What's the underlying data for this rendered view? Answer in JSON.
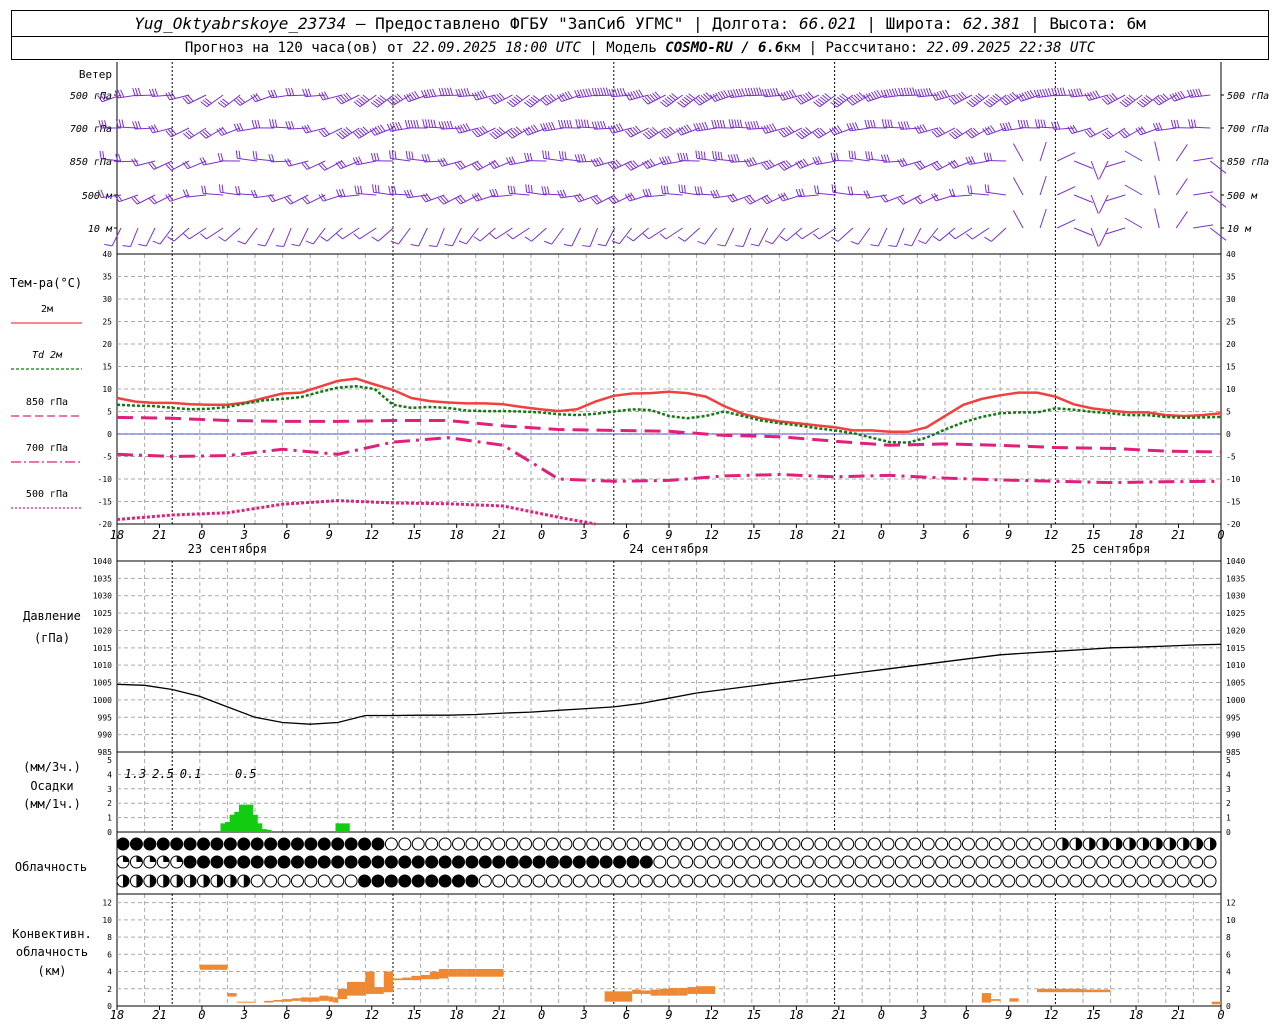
{
  "header": {
    "station": "Yug_Oktyabrskoye_23734",
    "provided_prefix": " – Предоставлено ФГБУ \"ЗапСиб УГМС\" | Долгота: ",
    "longitude": "66.021",
    "lat_prefix": " | Широта: ",
    "latitude": "62.381",
    "elev_prefix": " | Высота: ",
    "elevation": "6м",
    "forecast_prefix": "Прогноз на 120 часа(ов) от ",
    "forecast_start": "22.09.2025 18:00 UTC",
    "model_prefix": "  | Модель ",
    "model": "COSMO-RU / 6.6",
    "model_res_unit": "км",
    "calc_prefix": " | Рассчитано: ",
    "calculated": "22.09.2025 22:38 UTC"
  },
  "colors": {
    "t2m": "#f04040",
    "td2m": "#127a12",
    "t850": "#e0207a",
    "t700": "#e0207a",
    "t500": "#e0207a",
    "wind": "#7b2fd1",
    "pressure": "#000000",
    "precip": "#11cc11",
    "convective": "#ee8833",
    "zero_line": "#2020c0",
    "grid": "#aaaaaa"
  },
  "time_axis": {
    "hour_labels": [
      "18",
      "21",
      "0",
      "3",
      "6",
      "9",
      "12",
      "15",
      "18",
      "21",
      "0",
      "3",
      "6",
      "9",
      "12",
      "15",
      "18",
      "21",
      "0",
      "3",
      "6",
      "9",
      "12",
      "15",
      "18",
      "21",
      "0"
    ],
    "date_labels": [
      "23 сентября",
      "24 сентября",
      "25 сентября"
    ]
  },
  "wind": {
    "title": "Ветер",
    "levels": [
      "500 гПа",
      "700 гПа",
      "850 гПа",
      "500 м",
      "10  м"
    ],
    "right_levels": [
      "500 гПа",
      "700 гПа",
      "850 гПа",
      "500 м",
      "10  м"
    ]
  },
  "temperature": {
    "title": "Тем-ра(°C)",
    "legend": [
      "2м",
      "Td  2м",
      "850 гПа",
      "700 гПа",
      "500 гПа"
    ],
    "yticks": [
      "40",
      "35",
      "30",
      "25",
      "20",
      "15",
      "10",
      "5",
      "0",
      "-5",
      "-10",
      "-15",
      "-20"
    ]
  },
  "pressure": {
    "title": "Давление",
    "unit": "(гПа)",
    "yticks": [
      "1040",
      "1035",
      "1030",
      "1025",
      "1020",
      "1015",
      "1010",
      "1005",
      "1000",
      "995",
      "990",
      "985"
    ]
  },
  "precip": {
    "unit_top": "(мм/3ч.)",
    "title": "Осадки",
    "unit_bottom": "(мм/1ч.)",
    "yticks": [
      "5",
      "4",
      "3",
      "2",
      "1",
      "0"
    ],
    "labels": [
      {
        "hour": 1.5,
        "text": "1.3"
      },
      {
        "hour": 4.5,
        "text": "2.5"
      },
      {
        "hour": 7.5,
        "text": "0.1"
      },
      {
        "hour": 13.5,
        "text": "0.5"
      }
    ]
  },
  "cloud": {
    "title": "Облачность"
  },
  "convective": {
    "title_1": "Конвективн.",
    "title_2": "облачность",
    "unit": "(км)",
    "yticks": [
      "12",
      "10",
      "8",
      "6",
      "4",
      "2",
      "0"
    ]
  },
  "chart_data": [
    {
      "type": "line",
      "title": "Тем-ра(°C)",
      "x_unit": "hours from 22.09.2025 18:00 UTC",
      "ylim": [
        -20,
        40
      ],
      "series": [
        {
          "name": "2м",
          "x": [
            0,
            2,
            4,
            6,
            8,
            10,
            12,
            14,
            16,
            18,
            20,
            22,
            24,
            26,
            28,
            30,
            32,
            34,
            36,
            38,
            40,
            42,
            44,
            46,
            48,
            50,
            52,
            54,
            56,
            58,
            60,
            62,
            64,
            66,
            68,
            70,
            72,
            74,
            76,
            78,
            80,
            82,
            84,
            86,
            88,
            90,
            92,
            94,
            96,
            98,
            100,
            102,
            104,
            106,
            108,
            110,
            112,
            114,
            116,
            118,
            120
          ],
          "values": [
            8,
            7.2,
            6.9,
            6.9,
            6.6,
            6.5,
            6.5,
            7,
            8,
            9,
            9.2,
            10.5,
            11.8,
            12.3,
            11,
            9.8,
            8,
            7.3,
            7,
            6.8,
            6.8,
            6.6,
            6,
            5.5,
            5.1,
            5.5,
            7.2,
            8.5,
            9,
            9.1,
            9.4,
            9.1,
            8.3,
            6.2,
            4.5,
            3.5,
            2.8,
            2.4,
            1.9,
            1.5,
            0.8,
            0.8,
            0.5,
            0.5,
            1.5,
            4,
            6.5,
            7.8,
            8.6,
            9.2,
            9.2,
            8.3,
            6.6,
            5.7,
            5.2,
            4.8,
            4.8,
            4.2,
            4,
            4.2,
            4.6
          ]
        },
        {
          "name": "Td  2м",
          "x": [
            0,
            2,
            4,
            6,
            8,
            10,
            12,
            14,
            16,
            18,
            20,
            22,
            24,
            26,
            28,
            30,
            32,
            34,
            36,
            38,
            40,
            42,
            44,
            46,
            48,
            50,
            52,
            54,
            56,
            58,
            60,
            62,
            64,
            66,
            68,
            70,
            72,
            74,
            76,
            78,
            80,
            82,
            84,
            86,
            88,
            90,
            92,
            94,
            96,
            98,
            100,
            102,
            104,
            106,
            108,
            110,
            112,
            114,
            116,
            118,
            120
          ],
          "values": [
            6.5,
            6.3,
            6.2,
            5.8,
            5.5,
            5.6,
            6,
            6.8,
            7.5,
            7.8,
            8.2,
            9.3,
            10.3,
            10.6,
            10,
            6.5,
            5.8,
            6,
            5.8,
            5.2,
            5.1,
            5.1,
            5,
            4.8,
            4.4,
            4.2,
            4.5,
            5,
            5.5,
            5.3,
            4,
            3.5,
            4,
            5,
            4,
            3,
            2.4,
            1.9,
            1.3,
            0.8,
            0.2,
            -0.8,
            -1.8,
            -1.9,
            -0.8,
            1,
            2.6,
            3.8,
            4.6,
            4.8,
            4.8,
            5.7,
            5.4,
            4.9,
            4.6,
            4.2,
            4.2,
            3.8,
            3.6,
            3.7,
            3.8
          ]
        },
        {
          "name": "850 гПа",
          "x": [
            0,
            6,
            12,
            18,
            24,
            30,
            36,
            42,
            48,
            54,
            60,
            66,
            72,
            78,
            84,
            90,
            96,
            102,
            108,
            114,
            120
          ],
          "values": [
            3.7,
            3.5,
            3,
            2.8,
            2.8,
            3,
            3,
            1.8,
            1,
            0.8,
            0.6,
            -0.3,
            -0.6,
            -1.6,
            -2.5,
            -2.2,
            -2.5,
            -3,
            -3.2,
            -3.8,
            -4
          ]
        },
        {
          "name": "700 гПа",
          "x": [
            0,
            6,
            12,
            18,
            24,
            30,
            36,
            42,
            48,
            54,
            60,
            66,
            72,
            78,
            84,
            90,
            96,
            102,
            108,
            114,
            120
          ],
          "values": [
            -4.5,
            -5,
            -4.8,
            -3.4,
            -4.5,
            -1.8,
            -0.8,
            -2.5,
            -10,
            -10.5,
            -10.3,
            -9.3,
            -9,
            -9.5,
            -9.2,
            -9.8,
            -10.2,
            -10.5,
            -10.8,
            -10.6,
            -10.5
          ]
        },
        {
          "name": "500 гПа",
          "x": [
            0,
            6,
            12,
            18,
            24,
            30,
            36,
            42,
            48,
            52
          ],
          "values": [
            -19,
            -18,
            -17.5,
            -15.6,
            -14.8,
            -15.3,
            -15.5,
            -16,
            -18.5,
            -20
          ]
        }
      ]
    },
    {
      "type": "line",
      "title": "Давление",
      "x_unit": "hours from 22.09.2025 18:00 UTC",
      "ylim": [
        985,
        1040
      ],
      "series": [
        {
          "name": "",
          "x": [
            0,
            3,
            6,
            9,
            12,
            15,
            18,
            21,
            24,
            27,
            30,
            33,
            36,
            39,
            42,
            45,
            48,
            51,
            54,
            57,
            60,
            63,
            66,
            69,
            72,
            75,
            78,
            81,
            84,
            87,
            90,
            93,
            96,
            99,
            102,
            105,
            108,
            111,
            114,
            117,
            120
          ],
          "values": [
            1004.5,
            1004.2,
            1003,
            1001,
            998,
            995,
            993.5,
            993,
            993.5,
            995.5,
            995.5,
            995.6,
            995.6,
            995.8,
            996.2,
            996.5,
            997,
            997.5,
            998,
            999,
            1000.5,
            1002,
            1003,
            1004,
            1005,
            1006,
            1007,
            1008,
            1009,
            1010,
            1011,
            1012,
            1013,
            1013.5,
            1014,
            1014.5,
            1015,
            1015.2,
            1015.5,
            1015.8,
            1016
          ]
        }
      ]
    },
    {
      "type": "bar",
      "title": "Осадки",
      "x_unit": "hours from 22.09.2025 18:00 UTC",
      "ylim": [
        0,
        5
      ],
      "series": [
        {
          "name": "",
          "x": [
            10.5,
            11.5,
            12.5,
            13.5,
            14.5,
            15.5,
            16.5,
            17.5,
            18.5,
            19.5,
            20.5,
            21.5,
            22.5,
            23.5,
            24.5,
            25.5,
            26.5,
            27.5,
            28.5,
            29.5,
            30.5,
            31.5,
            32.5,
            33.5,
            34.5,
            35.5
          ],
          "values": [
            0.6,
            0.7,
            1.2,
            1.4,
            1.9,
            1.2,
            0.6,
            0.2,
            0.15,
            0,
            0,
            0,
            0,
            0,
            0,
            0,
            0,
            0,
            0,
            0,
            0,
            0,
            0,
            0,
            0,
            0.6
          ]
        }
      ]
    },
    {
      "type": "bar",
      "title": "Конвективн. облачность",
      "x_unit": "hours from 22.09.2025 18:00 UTC",
      "ylim": [
        0,
        13
      ],
      "series": [
        {
          "name": "",
          "x_from": [
            9,
            12,
            13,
            16,
            17,
            18,
            19,
            20,
            21,
            22,
            23,
            23.5,
            24,
            25,
            27,
            28,
            29,
            30,
            31,
            32,
            33,
            34,
            35,
            36,
            37,
            38,
            39,
            40,
            53,
            55,
            56,
            57,
            58,
            59,
            60,
            61,
            62,
            63,
            94,
            95,
            97,
            100,
            102,
            105,
            106,
            119
          ],
          "x_to": [
            12,
            13,
            15,
            17,
            18,
            19,
            20,
            21,
            22,
            23,
            23.5,
            24,
            25,
            27,
            28,
            29,
            30,
            31,
            32,
            33,
            34,
            35,
            36,
            37,
            38,
            39,
            40,
            42,
            55,
            56,
            57,
            58,
            59,
            60,
            61,
            62,
            63,
            65,
            95,
            96,
            98,
            105,
            105.5,
            106,
            108,
            120
          ],
          "top": [
            4.8,
            1.5,
            0.5,
            0.6,
            0.7,
            0.8,
            0.9,
            1.0,
            1.0,
            1.2,
            1.1,
            1.0,
            2.0,
            2.8,
            4.0,
            2.2,
            4.0,
            3.2,
            3.3,
            3.5,
            3.6,
            4.0,
            4.3,
            4.3,
            4.3,
            4.3,
            4.3,
            4.3,
            1.7,
            1.7,
            1.9,
            1.8,
            1.9,
            2.0,
            2.1,
            2.1,
            2.2,
            2.3,
            1.5,
            0.8,
            0.9,
            2.0,
            1.9,
            1.9,
            1.9,
            0.5
          ],
          "bottom": [
            4.2,
            1.1,
            0.4,
            0.4,
            0.5,
            0.5,
            0.6,
            0.5,
            0.5,
            0.6,
            0.5,
            0.4,
            0.8,
            1.2,
            1.4,
            1.4,
            1.6,
            3.0,
            3.0,
            3.0,
            3.1,
            3.1,
            3.2,
            3.4,
            3.4,
            3.4,
            3.4,
            3.4,
            0.5,
            0.5,
            1.4,
            1.4,
            1.2,
            1.2,
            1.2,
            1.2,
            1.4,
            1.4,
            0.4,
            0.6,
            0.5,
            1.6,
            1.7,
            1.6,
            1.6,
            0.2
          ]
        }
      ]
    }
  ]
}
